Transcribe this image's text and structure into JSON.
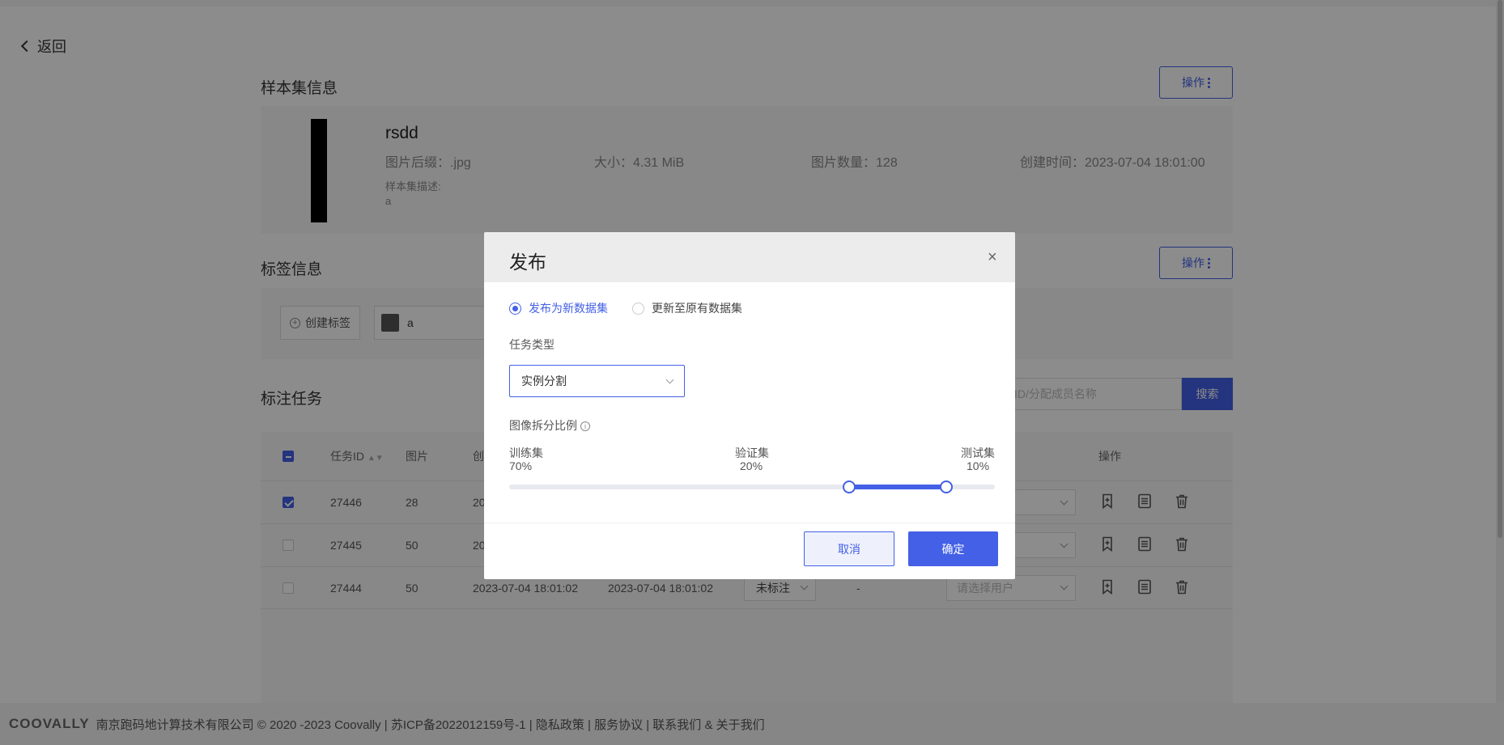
{
  "nav": {
    "back_label": "返回"
  },
  "dataset_section": {
    "title": "样本集信息",
    "action_label": "操作",
    "name": "rsdd",
    "suffix_label": "图片后缀：",
    "suffix_value": ".jpg",
    "size_label": "大小：",
    "size_value": "4.31 MiB",
    "count_label": "图片数量：",
    "count_value": "128",
    "created_label": "创建时间：",
    "created_value": "2023-07-04 18:01:00",
    "desc_label": "样本集描述:",
    "desc_value": "a"
  },
  "tag_section": {
    "title": "标签信息",
    "action_label": "操作",
    "create_label": "创建标签",
    "tags": [
      {
        "name": "a",
        "color": "#555555"
      }
    ]
  },
  "task_section": {
    "title": "标注任务",
    "search_placeholder": "务ID/分配成员名称",
    "search_label": "搜索",
    "columns": {
      "task_id": "任务ID",
      "images": "图片",
      "created": "创",
      "actions": "操作"
    },
    "rows": [
      {
        "checked": true,
        "id": "27446",
        "images": "28",
        "created": "20",
        "updated": "",
        "status": "",
        "user": ""
      },
      {
        "checked": false,
        "id": "27445",
        "images": "50",
        "created": "20",
        "updated": "",
        "status": "",
        "user": ""
      },
      {
        "checked": false,
        "id": "27444",
        "images": "50",
        "created": "2023-07-04 18:01:02",
        "updated": "2023-07-04 18:01:02",
        "status": "未标注",
        "dash": "-",
        "user": "请选择用户"
      }
    ]
  },
  "footer": {
    "logo": "COOVALLY",
    "text": "南京跑码地计算技术有限公司 © 2020 -2023 Coovally | 苏ICP备2022012159号-1 | 隐私政策 | 服务协议 | 联系我们 & 关于我们"
  },
  "modal": {
    "title": "发布",
    "close_glyph": "×",
    "option_new": "发布为新数据集",
    "option_update": "更新至原有数据集",
    "selected_option": "new",
    "task_type_label": "任务类型",
    "task_type_value": "实例分割",
    "split_label": "图像拆分比例",
    "train_label": "训练集",
    "train_value": "70%",
    "val_label": "验证集",
    "val_value": "20%",
    "test_label": "测试集",
    "test_value": "10%",
    "split_fractions": {
      "train": 0.7,
      "val": 0.2,
      "test": 0.1
    },
    "cancel_label": "取消",
    "confirm_label": "确定"
  },
  "colors": {
    "accent": "#4360e6",
    "overlay": "rgba(0,0,0,0.45)"
  }
}
